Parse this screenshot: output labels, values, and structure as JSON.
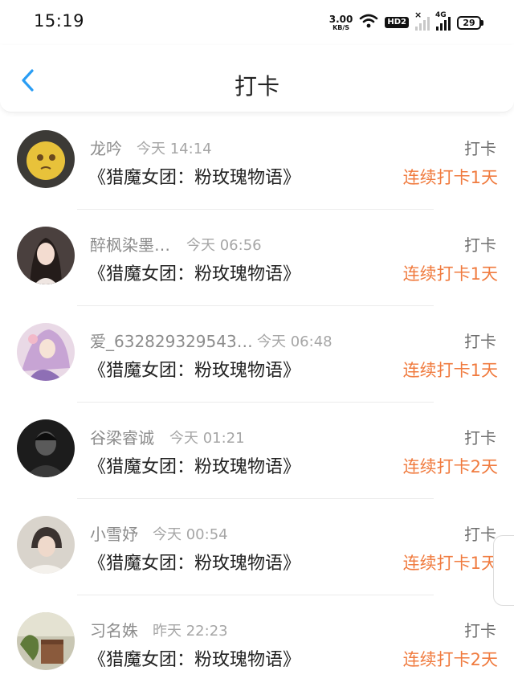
{
  "status_bar": {
    "time": "15:19",
    "net_speed_value": "3.00",
    "net_speed_unit": "KB/S",
    "hd_badge": "HD2",
    "network_type": "4G",
    "battery": "29"
  },
  "header": {
    "title": "打卡",
    "back_icon": "chevron-left-icon",
    "accent_color": "#2a9df4"
  },
  "colors": {
    "streak": "#f07b3f",
    "name": "#8c8c8c",
    "time": "#a6a6a6"
  },
  "checkins": [
    {
      "name": "龙吟",
      "time": "今天 14:14",
      "book": "《猎魔女团：粉玫瑰物语》",
      "action": "打卡",
      "streak": "连续打卡1天"
    },
    {
      "name": "醉枫染墨…",
      "time": "今天 06:56",
      "book": "《猎魔女团：粉玫瑰物语》",
      "action": "打卡",
      "streak": "连续打卡1天"
    },
    {
      "name": "爱_632829329543…",
      "time": "今天 06:48",
      "book": "《猎魔女团：粉玫瑰物语》",
      "action": "打卡",
      "streak": "连续打卡1天"
    },
    {
      "name": "谷梁睿诚",
      "time": "今天 01:21",
      "book": "《猎魔女团：粉玫瑰物语》",
      "action": "打卡",
      "streak": "连续打卡2天"
    },
    {
      "name": "小雪妤",
      "time": "今天 00:54",
      "book": "《猎魔女团：粉玫瑰物语》",
      "action": "打卡",
      "streak": "连续打卡1天"
    },
    {
      "name": "习名姝",
      "time": "昨天 22:23",
      "book": "《猎魔女团：粉玫瑰物语》",
      "action": "打卡",
      "streak": "连续打卡2天"
    }
  ]
}
